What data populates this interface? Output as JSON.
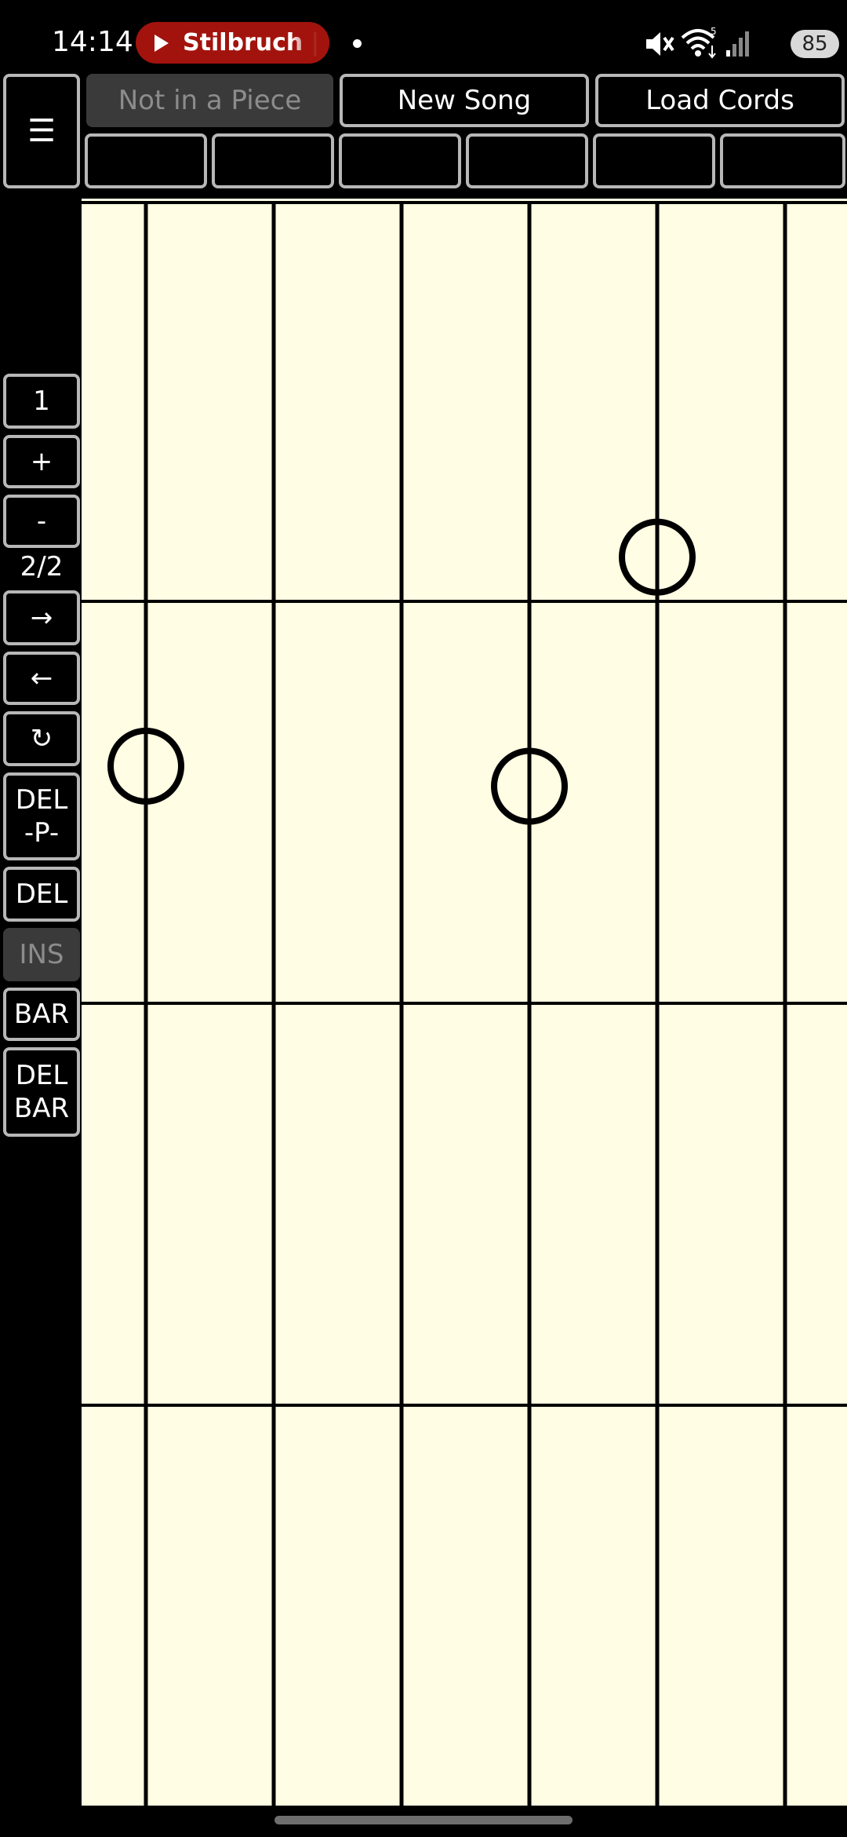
{
  "status_bar": {
    "time": "14:14",
    "media_chip": "Stilbruch | S",
    "battery": "85",
    "icons": [
      "play-icon",
      "mute-icon",
      "wifi-icon",
      "signal-icon",
      "battery-icon"
    ]
  },
  "toolbar": {
    "menu_label": "☰",
    "not_in_piece_label": "Not in a Piece",
    "new_song_label": "New Song",
    "load_chords_label": "Load Cords",
    "slots": [
      "",
      "",
      "",
      "",
      "",
      ""
    ]
  },
  "sidebar": {
    "one_label": "1",
    "plus_label": "+",
    "minus_label": "-",
    "page": "2/2",
    "next_label": "→",
    "prev_label": "←",
    "refresh_label": "↻",
    "del_p_label": "DEL\n-P-",
    "del_label": "DEL",
    "ins_label": "INS",
    "bar_label": "BAR",
    "del_bar_label": "DEL\nBAR"
  },
  "fretboard": {
    "strings": 6,
    "bars_visible": 4,
    "background": "#fffde3",
    "markers": [
      {
        "string": 5,
        "bar": 1,
        "pos": 0.89
      },
      {
        "string": 1,
        "bar": 2,
        "pos": 0.41
      },
      {
        "string": 4,
        "bar": 2,
        "pos": 0.46
      }
    ]
  }
}
